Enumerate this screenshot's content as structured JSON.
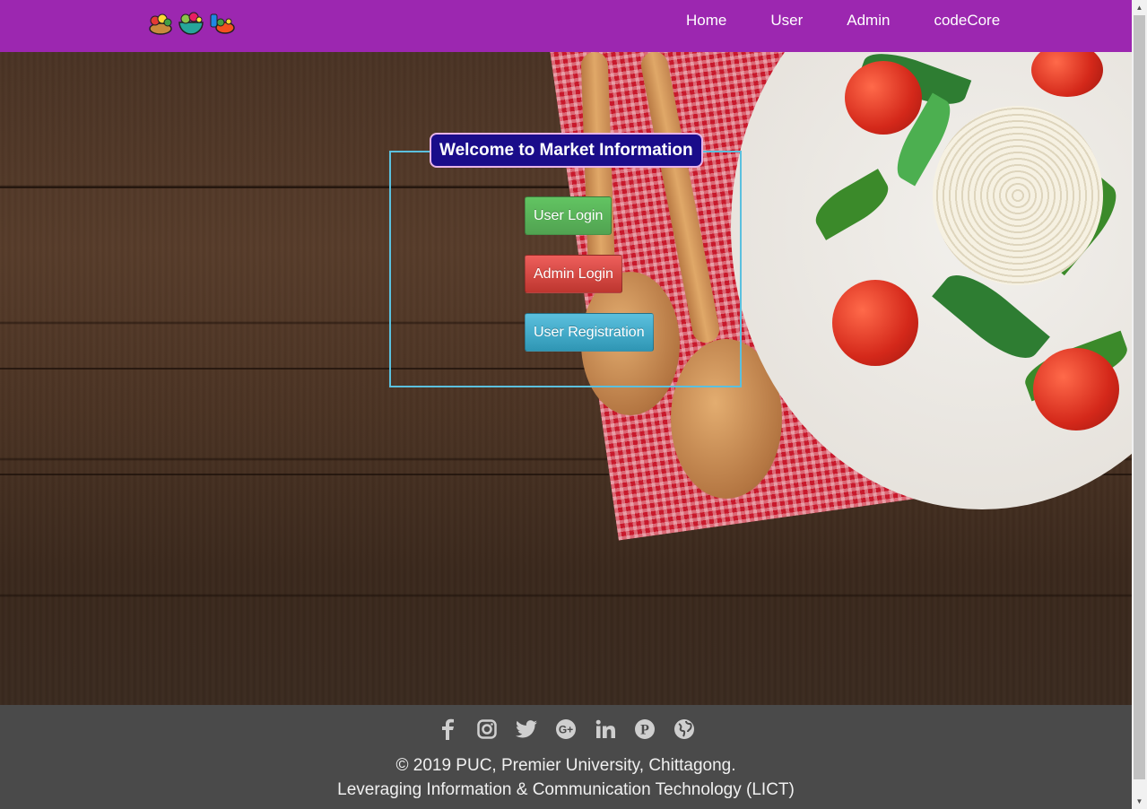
{
  "nav": {
    "links": [
      {
        "label": "Home"
      },
      {
        "label": "User"
      },
      {
        "label": "Admin"
      },
      {
        "label": "codeCore"
      }
    ]
  },
  "panel": {
    "title": "Welcome to Market Information",
    "buttons": {
      "user_login": "User Login",
      "admin_login": "Admin Login",
      "user_registration": "User Registration"
    }
  },
  "footer": {
    "social_icons": [
      "facebook-icon",
      "instagram-icon",
      "twitter-icon",
      "google-plus-icon",
      "linkedin-icon",
      "pinterest-icon",
      "globe-icon"
    ],
    "copyright": "© 2019 PUC, Premier University, Chittagong.",
    "tagline": "Leveraging Information & Communication Technology (LICT)"
  },
  "colors": {
    "navbar": "#9c27b0",
    "panel_border": "#5bc0de",
    "title_bg": "#1a0c8a",
    "success": "#5cb85c",
    "danger": "#d9534f",
    "info": "#5bc0de",
    "footer": "#4a4a4a"
  }
}
